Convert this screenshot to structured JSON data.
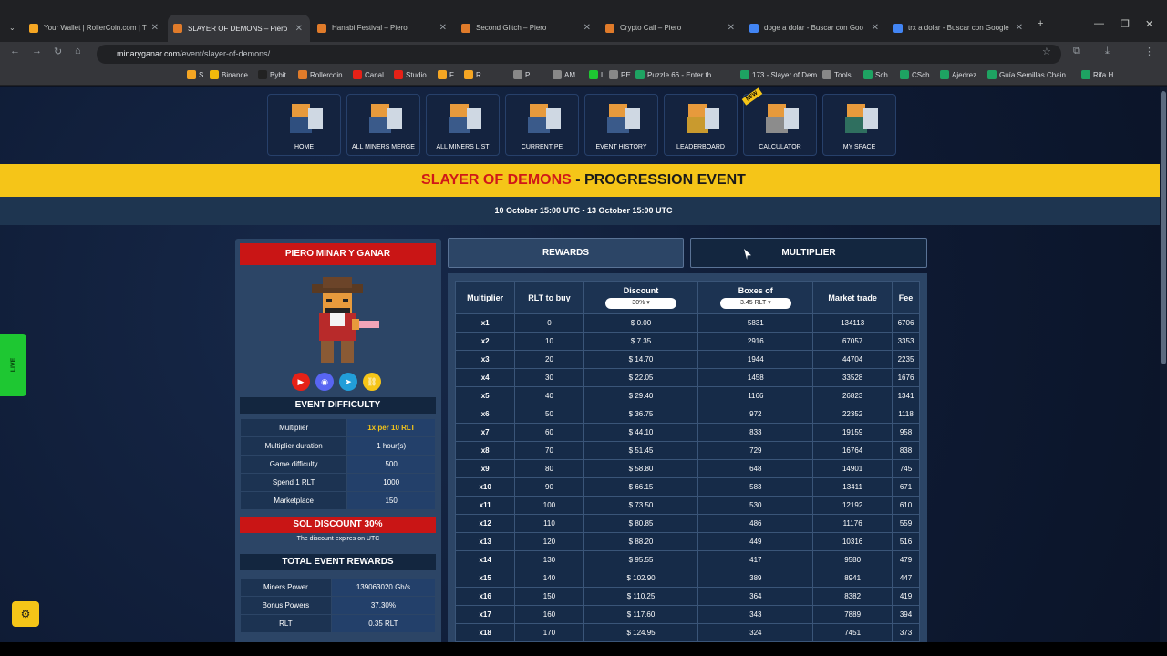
{
  "browser": {
    "tabs": [
      {
        "title": "Your Wallet | RollerCoin.com | T",
        "color": "#f5a623"
      },
      {
        "title": "SLAYER OF DEMONS – Piero",
        "color": "#e07b2a"
      },
      {
        "title": "Hanabi Festival – Piero",
        "color": "#e07b2a"
      },
      {
        "title": "Second Glitch – Piero",
        "color": "#e07b2a"
      },
      {
        "title": "Crypto Call – Piero",
        "color": "#e07b2a"
      },
      {
        "title": "doge a dolar - Buscar con Goo",
        "color": "#4285f4"
      },
      {
        "title": "trx a dolar - Buscar con Google",
        "color": "#4285f4"
      }
    ],
    "url_domain": "minaryganar.com",
    "url_path": "/event/slayer-of-demons/",
    "bookmarks": [
      "S",
      "Binance",
      "Bybit",
      "Rollercoin",
      "Canal",
      "Studio",
      "F",
      "R",
      "P",
      "AM",
      "L",
      "PE",
      "Puzzle 66.- Enter th...",
      "173.- Slayer of Dem...",
      "Tools",
      "Sch",
      "CSch",
      "Ajedrez",
      "Guía Semillas Chain...",
      "Rifa H"
    ]
  },
  "nav": [
    "HOME",
    "ALL MINERS MERGE",
    "ALL MINERS LIST",
    "CURRENT PE",
    "EVENT HISTORY",
    "LEADERBOARD",
    "CALCULATOR",
    "MY SPACE"
  ],
  "new_badge": "NEW",
  "event": {
    "name": "SLAYER OF DEMONS",
    "suffix": " - PROGRESSION EVENT",
    "dates": "10 October 15:00 UTC - 13 October 15:00 UTC"
  },
  "left": {
    "player": "PIERO MINAR Y GANAR",
    "difficulty_title": "EVENT DIFFICULTY",
    "difficulty": [
      [
        "Multiplier",
        "1x per 10 RLT"
      ],
      [
        "Multiplier duration",
        "1 hour(s)"
      ],
      [
        "Game difficulty",
        "500"
      ],
      [
        "Spend 1 RLT",
        "1000"
      ],
      [
        "Marketplace",
        "150"
      ]
    ],
    "discount_title": "SOL DISCOUNT 30%",
    "discount_note": "The discount expires on UTC",
    "rewards_title": "TOTAL EVENT REWARDS",
    "rewards": [
      [
        "Miners Power",
        "139063020 Gh/s"
      ],
      [
        "Bonus Powers",
        "37.30%"
      ],
      [
        "RLT",
        "0.35 RLT"
      ]
    ]
  },
  "tabs": {
    "rewards": "REWARDS",
    "multiplier": "MULTIPLIER"
  },
  "table": {
    "headers": [
      "Multiplier",
      "RLT to buy",
      "Discount",
      "Boxes of",
      "Market trade",
      "Fee"
    ],
    "discount_select": "30%",
    "boxes_select": "3.45 RLT",
    "rows": [
      [
        "x1",
        "0",
        "$ 0.00",
        "5831",
        "134113",
        "6706"
      ],
      [
        "x2",
        "10",
        "$ 7.35",
        "2916",
        "67057",
        "3353"
      ],
      [
        "x3",
        "20",
        "$ 14.70",
        "1944",
        "44704",
        "2235"
      ],
      [
        "x4",
        "30",
        "$ 22.05",
        "1458",
        "33528",
        "1676"
      ],
      [
        "x5",
        "40",
        "$ 29.40",
        "1166",
        "26823",
        "1341"
      ],
      [
        "x6",
        "50",
        "$ 36.75",
        "972",
        "22352",
        "1118"
      ],
      [
        "x7",
        "60",
        "$ 44.10",
        "833",
        "19159",
        "958"
      ],
      [
        "x8",
        "70",
        "$ 51.45",
        "729",
        "16764",
        "838"
      ],
      [
        "x9",
        "80",
        "$ 58.80",
        "648",
        "14901",
        "745"
      ],
      [
        "x10",
        "90",
        "$ 66.15",
        "583",
        "13411",
        "671"
      ],
      [
        "x11",
        "100",
        "$ 73.50",
        "530",
        "12192",
        "610"
      ],
      [
        "x12",
        "110",
        "$ 80.85",
        "486",
        "11176",
        "559"
      ],
      [
        "x13",
        "120",
        "$ 88.20",
        "449",
        "10316",
        "516"
      ],
      [
        "x14",
        "130",
        "$ 95.55",
        "417",
        "9580",
        "479"
      ],
      [
        "x15",
        "140",
        "$ 102.90",
        "389",
        "8941",
        "447"
      ],
      [
        "x16",
        "150",
        "$ 110.25",
        "364",
        "8382",
        "419"
      ],
      [
        "x17",
        "160",
        "$ 117.60",
        "343",
        "7889",
        "394"
      ],
      [
        "x18",
        "170",
        "$ 124.95",
        "324",
        "7451",
        "373"
      ]
    ]
  },
  "live_label": "LIVE"
}
